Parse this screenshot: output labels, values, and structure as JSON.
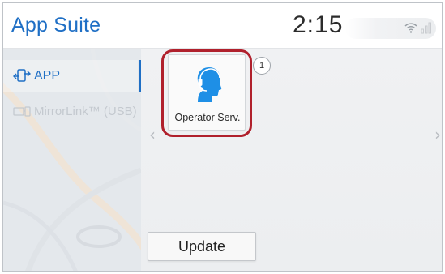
{
  "header": {
    "title": "App Suite",
    "clock": "2:15"
  },
  "sidebar": {
    "items": [
      {
        "label": "APP",
        "icon": "phone-link-icon",
        "state": "selected"
      },
      {
        "label": "MirrorLink™ (USB)",
        "icon": "mirror-link-icon",
        "state": "disabled"
      }
    ]
  },
  "main": {
    "tiles": [
      {
        "label": "Operator Serv.",
        "icon": "operator-headset-icon",
        "badge": "1",
        "highlighted": true
      }
    ],
    "update_label": "Update",
    "prev_arrow": "‹",
    "next_arrow": "›"
  },
  "colors": {
    "accent": "#1f6fc5",
    "highlight_ring": "#b0202c"
  }
}
